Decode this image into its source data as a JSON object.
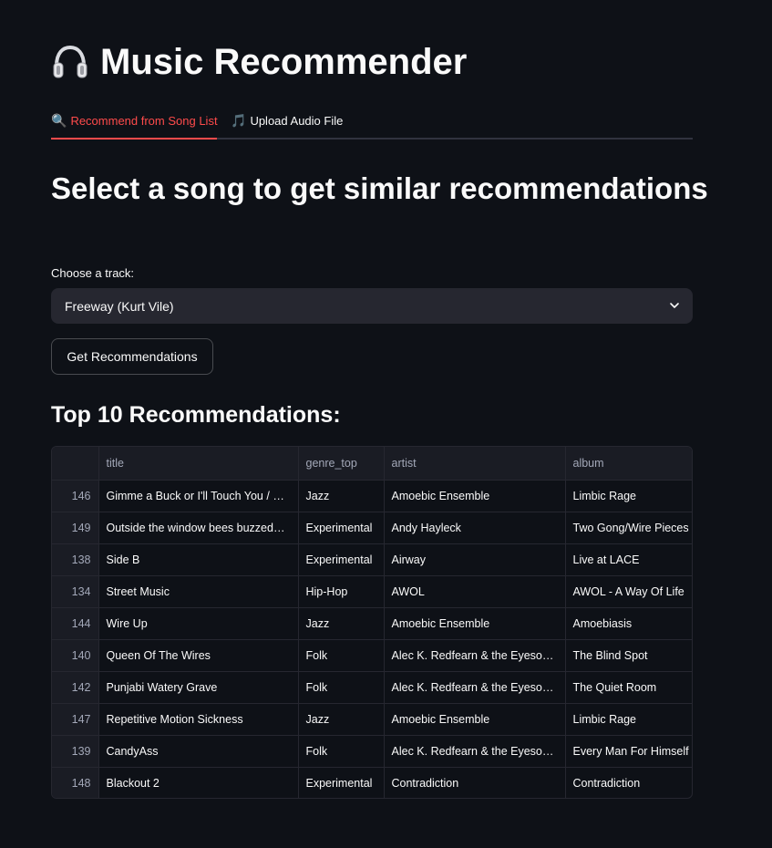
{
  "app": {
    "title": "Music Recommender",
    "title_icon": "headphones-icon"
  },
  "tabs": [
    {
      "icon": "🔍",
      "icon_name": "magnifier-icon",
      "label": "Recommend from Song List",
      "active": true
    },
    {
      "icon": "🎵",
      "icon_name": "music-note-icon",
      "label": "Upload Audio File",
      "active": false
    }
  ],
  "main": {
    "subtitle": "Select a song to get similar recommendations",
    "select_label": "Choose a track:",
    "selected_track": "Freeway (Kurt Vile)",
    "button_label": "Get Recommendations",
    "results_title": "Top 10 Recommendations:"
  },
  "table": {
    "columns": [
      "",
      "title",
      "genre_top",
      "artist",
      "album"
    ],
    "rows": [
      [
        "146",
        "Gimme a Buck or I'll Touch You / Boil",
        "Jazz",
        "Amoebic Ensemble",
        "Limbic Rage"
      ],
      [
        "149",
        "Outside the window bees buzzed…",
        "Experimental",
        "Andy Hayleck",
        "Two Gong/Wire Pieces"
      ],
      [
        "138",
        "Side B",
        "Experimental",
        "Airway",
        "Live at LACE"
      ],
      [
        "134",
        "Street Music",
        "Hip-Hop",
        "AWOL",
        "AWOL - A Way Of Life"
      ],
      [
        "144",
        "Wire Up",
        "Jazz",
        "Amoebic Ensemble",
        "Amoebiasis"
      ],
      [
        "140",
        "Queen Of The Wires",
        "Folk",
        "Alec K. Redfearn & the Eyesores",
        "The Blind Spot"
      ],
      [
        "142",
        "Punjabi Watery Grave",
        "Folk",
        "Alec K. Redfearn & the Eyesores",
        "The Quiet Room"
      ],
      [
        "147",
        "Repetitive Motion Sickness",
        "Jazz",
        "Amoebic Ensemble",
        "Limbic Rage"
      ],
      [
        "139",
        "CandyAss",
        "Folk",
        "Alec K. Redfearn & the Eyesores",
        "Every Man For Himself"
      ],
      [
        "148",
        "Blackout 2",
        "Experimental",
        "Contradiction",
        "Contradiction"
      ]
    ]
  },
  "colors": {
    "background": "#0e1117",
    "accent": "#ff4b4b",
    "input_bg": "#262730",
    "text": "#fafafa",
    "muted_text": "#a3a8b8"
  }
}
